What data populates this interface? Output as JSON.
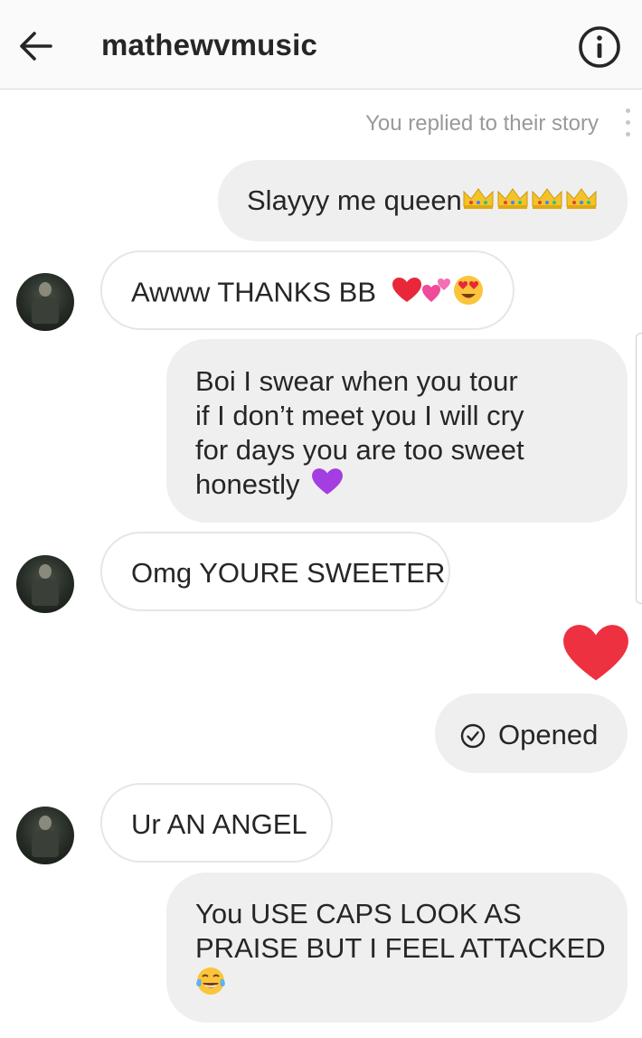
{
  "header": {
    "username": "mathewvmusic",
    "back_icon": "arrow-left-icon",
    "info_icon": "info-circle-icon"
  },
  "story_note": "You replied to their story",
  "messages": [
    {
      "sender": "me",
      "text": "Slayyy me queen",
      "emoji": [
        "crown",
        "crown",
        "crown",
        "crown"
      ]
    },
    {
      "sender": "them",
      "text": "Awww THANKS BB",
      "emoji": [
        "red-heart",
        "two-hearts",
        "heart-eyes"
      ]
    },
    {
      "sender": "me",
      "lines": [
        "Boi I swear when you tour",
        "if I don’t meet you I will cry",
        "for days you are too sweet",
        "honestly"
      ],
      "emoji": [
        "purple-heart"
      ]
    },
    {
      "sender": "them",
      "text": "Omg YOURE SWEETER"
    },
    {
      "sender": "me",
      "reaction": "red-heart"
    },
    {
      "sender": "me",
      "status": "Opened",
      "icon": "check-circle-icon"
    },
    {
      "sender": "them",
      "text": "Ur AN ANGEL"
    },
    {
      "sender": "me",
      "lines": [
        "You USE CAPS LOOK AS",
        "PRAISE BUT I FEEL ATTACKED"
      ],
      "emoji": [
        "tears-of-joy"
      ]
    }
  ],
  "colors": {
    "my_bubble": "#efefef",
    "their_bubble_border": "#e6e6e6",
    "header_bg": "#fafafa",
    "heart_red": "#ed3140",
    "purple_heart": "#a43ee0"
  }
}
